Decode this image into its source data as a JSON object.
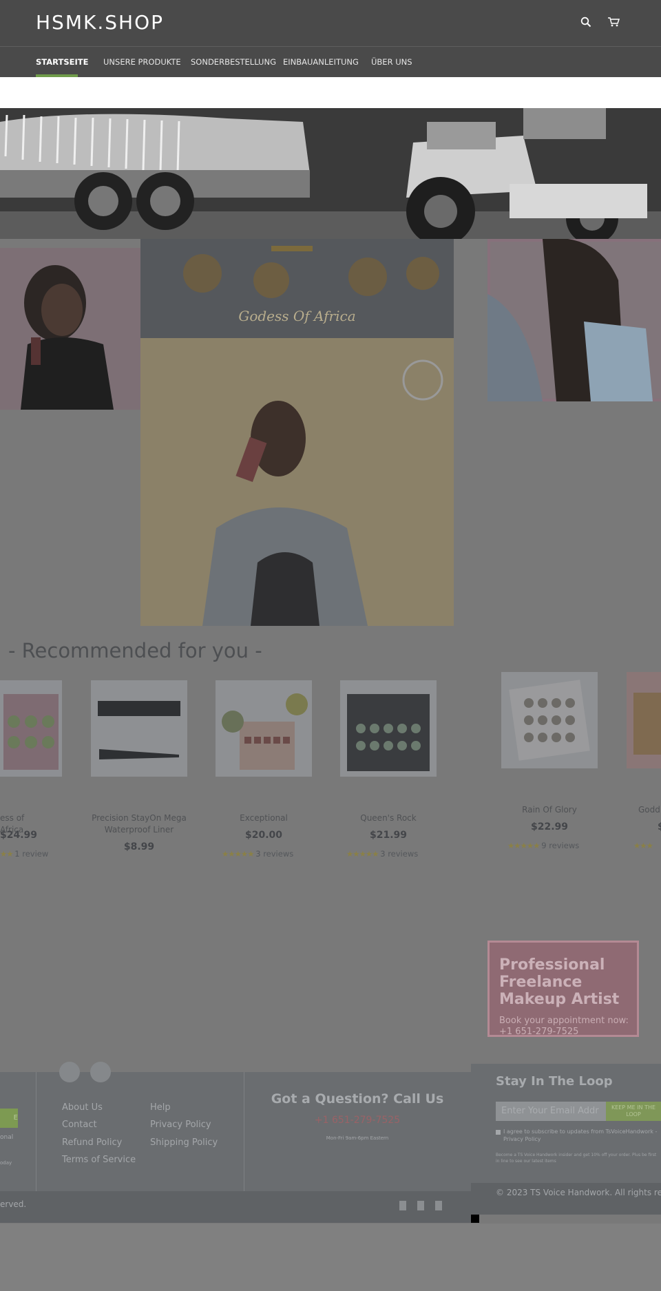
{
  "header": {
    "logo": "HSMK.SHOP",
    "search_icon": "search-icon",
    "cart_icon": "cart-icon",
    "nav": [
      {
        "label": "STARTSEITE",
        "active": true
      },
      {
        "label": "UNSERE PRODUKTE"
      },
      {
        "label": "SONDERBESTELLUNG"
      },
      {
        "label": "EINBAUANLEITUNG"
      },
      {
        "label": "ÜBER UNS"
      }
    ]
  },
  "promo_banner": {
    "caption": "Godess Of Africa"
  },
  "recommended": {
    "title": "- Recommended for you -",
    "products": [
      {
        "name": "ess of Africa",
        "price": "$24.99",
        "reviews": "1 review",
        "rating": 5
      },
      {
        "name": "Precision StayOn Mega Waterproof Liner",
        "price": "$8.99"
      },
      {
        "name": "Exceptional",
        "price": "$20.00",
        "reviews": "3 reviews",
        "rating": 5
      },
      {
        "name": "Queen's Rock",
        "price": "$21.99",
        "reviews": "3 reviews",
        "rating": 5
      },
      {
        "name": "Rain Of Glory",
        "price": "$22.99",
        "reviews": "9 reviews",
        "rating": 5
      },
      {
        "name": "Godd",
        "price": "$",
        "reviews": "",
        "rating": 5
      }
    ]
  },
  "ad": {
    "title": "Professional Freelance Makeup Artist",
    "subtitle": "Book your appointment now: +1 651-279-7525"
  },
  "footer": {
    "left_snippets": {
      "button": "E",
      "line1": "onal",
      "line2": "oday"
    },
    "links_col1": [
      "About Us",
      "Contact",
      "Refund Policy",
      "Terms of Service"
    ],
    "links_col2": [
      "Help",
      "Privacy Policy",
      "Shipping Policy"
    ],
    "question_title": "Got a Question? Call Us",
    "question_phone": "+1 651-279-7525",
    "question_note": "Mon-Fri 9am-6pm Eastern",
    "copyright_left": "erved.",
    "newsletter": {
      "title": "Stay In The Loop",
      "placeholder": "Enter Your Email Addr",
      "button": "KEEP ME IN THE LOOP",
      "consent": "I agree to subscribe to updates from TsVoiceHandwork - Privacy Policy",
      "note": "Become a TS Voice Handwork insider and get 10% off your order. Plus be first in line to see our latest items"
    },
    "copyright_right": "© 2023 TS Voice Handwork. All rights res"
  }
}
